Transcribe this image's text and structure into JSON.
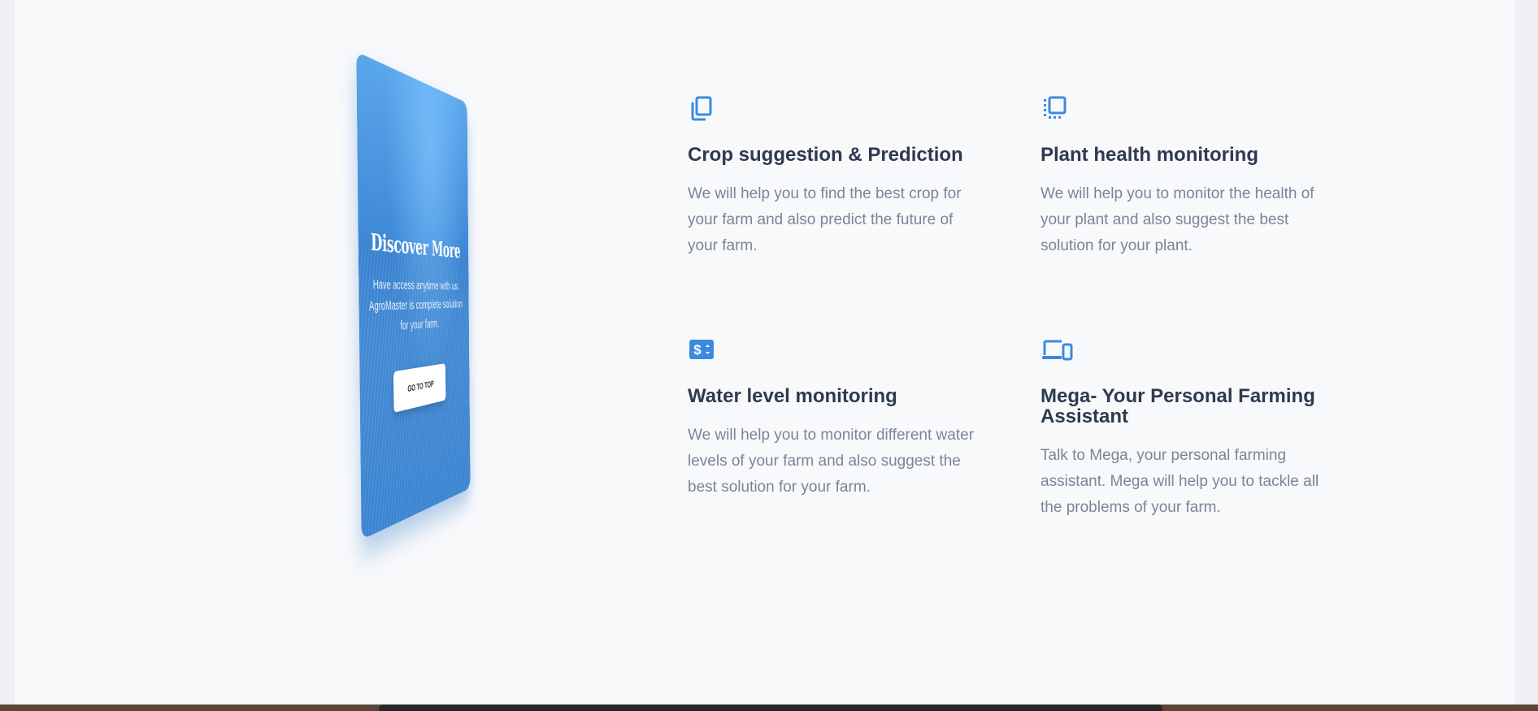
{
  "promo": {
    "title": "Discover More",
    "text": "Have access anytime with us. AgroMaster is complete solution for your farm.",
    "button_label": "GO TO TOP"
  },
  "features": [
    {
      "icon": "copy-icon",
      "title": "Crop suggestion & Prediction",
      "description": "We will help you to find the best crop for your farm and also predict the future of your farm."
    },
    {
      "icon": "select-frame-icon",
      "title": "Plant health monitoring",
      "description": "We will help you to monitor the health of your plant and also suggest the best solution for your plant."
    },
    {
      "icon": "money-icon",
      "title": "Water level monitoring",
      "description": "We will help you to monitor different water levels of your farm and also suggest the best solution for your farm."
    },
    {
      "icon": "devices-icon",
      "title": "Mega- Your Personal Farming Assistant",
      "description": "Talk to Mega, your personal farming assistant. Mega will help you to tackle all the problems of your farm."
    }
  ],
  "colors": {
    "accent": "#3b8ae0",
    "heading": "#2d3a4f",
    "body_text": "#7b8596",
    "background": "#f8f9fb"
  }
}
